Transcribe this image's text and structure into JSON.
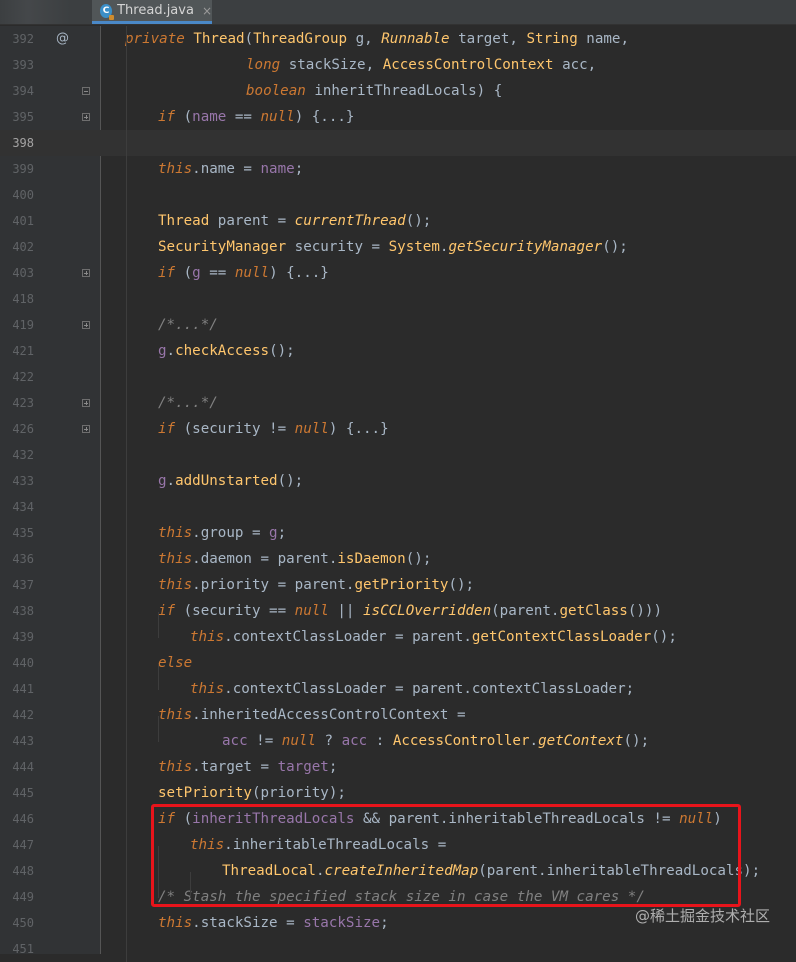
{
  "tab": {
    "icon": "java-class-icon",
    "icon_letter": "C",
    "title": "Thread.java",
    "close": "×"
  },
  "gutter_marker": "@",
  "lines": [
    {
      "n": "392",
      "segs": [
        [
          "kwi",
          "private "
        ],
        [
          "fn2",
          "Thread"
        ],
        [
          "pu",
          "("
        ],
        [
          "ty2",
          "ThreadGroup "
        ],
        [
          "pu",
          "g, "
        ],
        [
          "rit",
          "Runnable "
        ],
        [
          "pu",
          "target, "
        ],
        [
          "ty2",
          "String "
        ],
        [
          "pu",
          "name,"
        ]
      ]
    },
    {
      "n": "393",
      "segs": [
        [
          "kwi",
          "long "
        ],
        [
          "pu",
          "stackSize, "
        ],
        [
          "ty2",
          "AccessControlContext "
        ],
        [
          "pu",
          "acc,"
        ]
      ]
    },
    {
      "n": "394",
      "segs": [
        [
          "kwi",
          "boolean "
        ],
        [
          "pu",
          "inheritThreadLocals) {"
        ]
      ]
    },
    {
      "n": "395",
      "segs": [
        [
          "kwi",
          "if "
        ],
        [
          "pu",
          "("
        ],
        [
          "fld",
          "name"
        ],
        [
          "pu",
          " == "
        ],
        [
          "kwi",
          "null"
        ],
        [
          "pu",
          ") {...}"
        ]
      ]
    },
    {
      "n": "398",
      "segs": []
    },
    {
      "n": "399",
      "segs": [
        [
          "kwi",
          "this"
        ],
        [
          "pu",
          ".name = "
        ],
        [
          "fld",
          "name"
        ],
        [
          "pu",
          ";"
        ]
      ]
    },
    {
      "n": "400",
      "segs": []
    },
    {
      "n": "401",
      "segs": [
        [
          "ty2",
          "Thread "
        ],
        [
          "pu",
          "parent = "
        ],
        [
          "mi",
          "currentThread"
        ],
        [
          "pu",
          "();"
        ]
      ]
    },
    {
      "n": "402",
      "segs": [
        [
          "ty2",
          "SecurityManager "
        ],
        [
          "pu",
          "security = "
        ],
        [
          "ty2",
          "System"
        ],
        [
          "pu",
          "."
        ],
        [
          "mi",
          "getSecurityManager"
        ],
        [
          "pu",
          "();"
        ]
      ]
    },
    {
      "n": "403",
      "segs": [
        [
          "kwi",
          "if "
        ],
        [
          "pu",
          "("
        ],
        [
          "fld",
          "g"
        ],
        [
          "pu",
          " == "
        ],
        [
          "kwi",
          "null"
        ],
        [
          "pu",
          ") {...}"
        ]
      ]
    },
    {
      "n": "418",
      "segs": []
    },
    {
      "n": "419",
      "segs": [
        [
          "cm",
          "/*...*/"
        ]
      ]
    },
    {
      "n": "421",
      "segs": [
        [
          "fld",
          "g"
        ],
        [
          "pu",
          "."
        ],
        [
          "mt",
          "checkAccess"
        ],
        [
          "pu",
          "();"
        ]
      ]
    },
    {
      "n": "422",
      "segs": []
    },
    {
      "n": "423",
      "segs": [
        [
          "cm",
          "/*...*/"
        ]
      ]
    },
    {
      "n": "426",
      "segs": [
        [
          "kwi",
          "if "
        ],
        [
          "pu",
          "(security != "
        ],
        [
          "kwi",
          "null"
        ],
        [
          "pu",
          ") {...}"
        ]
      ]
    },
    {
      "n": "432",
      "segs": []
    },
    {
      "n": "433",
      "segs": [
        [
          "fld",
          "g"
        ],
        [
          "pu",
          "."
        ],
        [
          "mt",
          "addUnstarted"
        ],
        [
          "pu",
          "();"
        ]
      ]
    },
    {
      "n": "434",
      "segs": []
    },
    {
      "n": "435",
      "segs": [
        [
          "kwi",
          "this"
        ],
        [
          "pu",
          ".group = "
        ],
        [
          "fld",
          "g"
        ],
        [
          "pu",
          ";"
        ]
      ]
    },
    {
      "n": "436",
      "segs": [
        [
          "kwi",
          "this"
        ],
        [
          "pu",
          ".daemon = parent."
        ],
        [
          "mt",
          "isDaemon"
        ],
        [
          "pu",
          "();"
        ]
      ]
    },
    {
      "n": "437",
      "segs": [
        [
          "kwi",
          "this"
        ],
        [
          "pu",
          ".priority = parent."
        ],
        [
          "mt",
          "getPriority"
        ],
        [
          "pu",
          "();"
        ]
      ]
    },
    {
      "n": "438",
      "segs": [
        [
          "kwi",
          "if "
        ],
        [
          "pu",
          "(security == "
        ],
        [
          "kwi",
          "null"
        ],
        [
          "pu",
          " || "
        ],
        [
          "mi",
          "isCCLOverridden"
        ],
        [
          "pu",
          "(parent."
        ],
        [
          "mt",
          "getClass"
        ],
        [
          "pu",
          "()))"
        ]
      ]
    },
    {
      "n": "439",
      "segs": [
        [
          "kwi",
          "this"
        ],
        [
          "pu",
          ".contextClassLoader = parent."
        ],
        [
          "mt",
          "getContextClassLoader"
        ],
        [
          "pu",
          "();"
        ]
      ]
    },
    {
      "n": "440",
      "segs": [
        [
          "kwi",
          "else"
        ]
      ]
    },
    {
      "n": "441",
      "segs": [
        [
          "kwi",
          "this"
        ],
        [
          "pu",
          ".contextClassLoader = parent.contextClassLoader;"
        ]
      ]
    },
    {
      "n": "442",
      "segs": [
        [
          "kwi",
          "this"
        ],
        [
          "pu",
          ".inheritedAccessControlContext ="
        ]
      ]
    },
    {
      "n": "443",
      "segs": [
        [
          "fld",
          "acc"
        ],
        [
          "pu",
          " != "
        ],
        [
          "kwi",
          "null"
        ],
        [
          "pu",
          " ? "
        ],
        [
          "fld",
          "acc"
        ],
        [
          "pu",
          " : "
        ],
        [
          "ty2",
          "AccessController"
        ],
        [
          "pu",
          "."
        ],
        [
          "mi",
          "getContext"
        ],
        [
          "pu",
          "();"
        ]
      ]
    },
    {
      "n": "444",
      "segs": [
        [
          "kwi",
          "this"
        ],
        [
          "pu",
          ".target = "
        ],
        [
          "fld",
          "target"
        ],
        [
          "pu",
          ";"
        ]
      ]
    },
    {
      "n": "445",
      "segs": [
        [
          "mt",
          "setPriority"
        ],
        [
          "pu",
          "(priority);"
        ]
      ]
    },
    {
      "n": "446",
      "segs": [
        [
          "kwi",
          "if "
        ],
        [
          "pu",
          "("
        ],
        [
          "fld",
          "inheritThreadLocals"
        ],
        [
          "pu",
          " && parent.inheritableThreadLocals != "
        ],
        [
          "kwi",
          "null"
        ],
        [
          "pu",
          ")"
        ]
      ]
    },
    {
      "n": "447",
      "segs": [
        [
          "kwi",
          "this"
        ],
        [
          "pu",
          ".inheritableThreadLocals ="
        ]
      ]
    },
    {
      "n": "448",
      "segs": [
        [
          "ty2",
          "ThreadLocal"
        ],
        [
          "pu",
          "."
        ],
        [
          "mi",
          "createInheritedMap"
        ],
        [
          "pu",
          "(parent.inheritableThreadLocals);"
        ]
      ]
    },
    {
      "n": "449",
      "segs": [
        [
          "cm",
          "/* Stash the specified stack size in case the VM cares */"
        ]
      ]
    },
    {
      "n": "450",
      "segs": [
        [
          "kwi",
          "this"
        ],
        [
          "pu",
          ".stackSize = "
        ],
        [
          "fld",
          "stackSize"
        ],
        [
          "pu",
          ";"
        ]
      ]
    },
    {
      "n": "451",
      "segs": []
    }
  ],
  "watermark": "@稀土掘金技术社区",
  "colors": {
    "background": "#2b2b2b",
    "keyword": "#cc7832",
    "method": "#ffc66d",
    "field": "#9876aa",
    "comment": "#808080",
    "highlight_box": "#e8141b"
  }
}
